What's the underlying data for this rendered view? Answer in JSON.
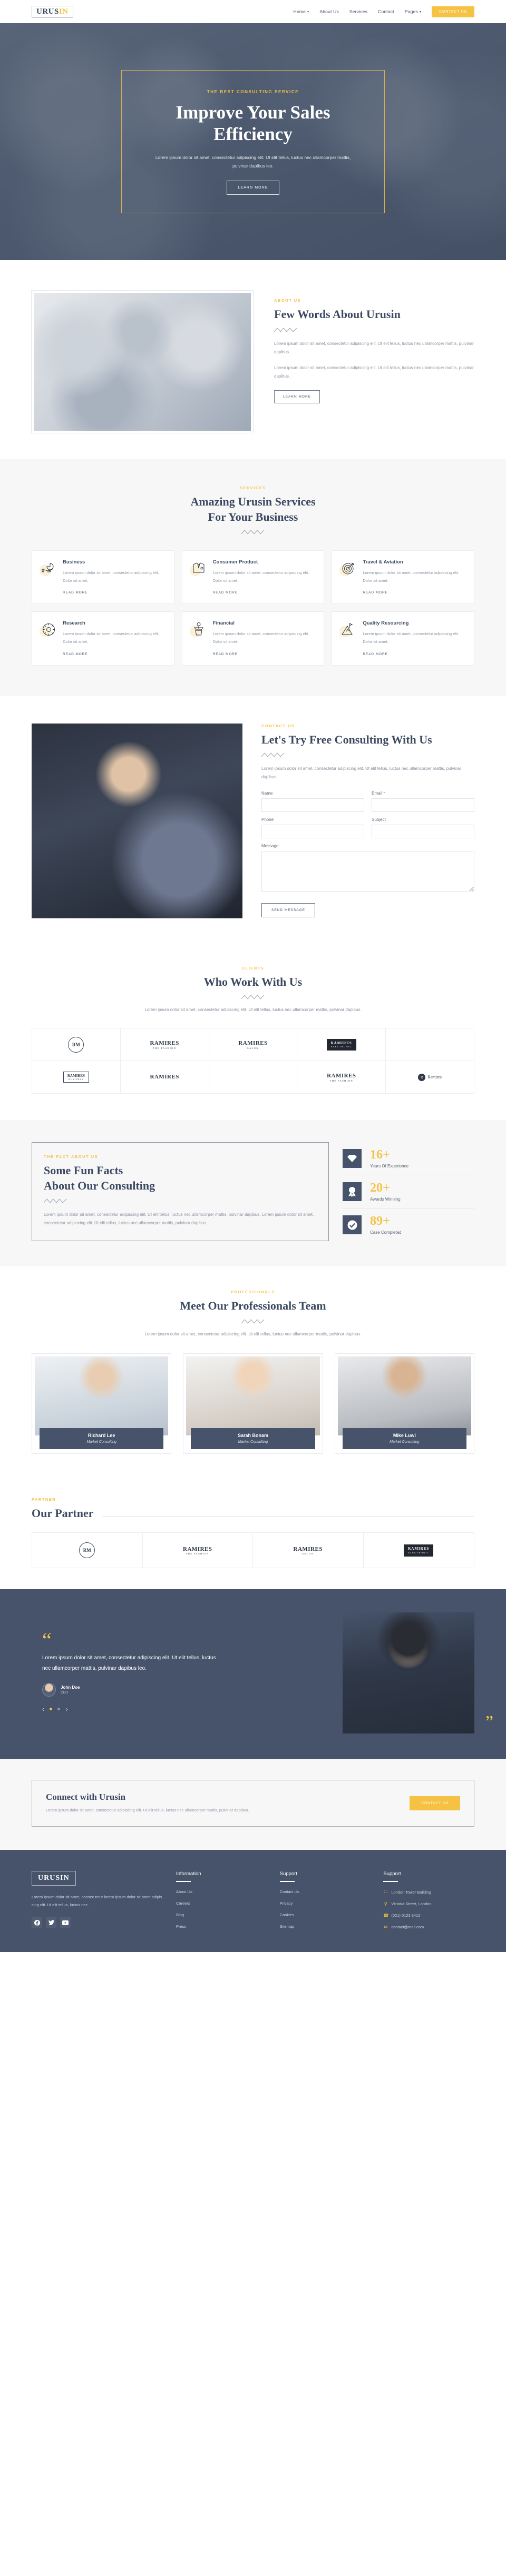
{
  "brand": {
    "name_dark": "URUS",
    "name_accent": "IN",
    "full": "URUSIN"
  },
  "nav": {
    "items": [
      {
        "label": "Home",
        "caret": "▾"
      },
      {
        "label": "About Us",
        "caret": ""
      },
      {
        "label": "Services",
        "caret": ""
      },
      {
        "label": "Contact",
        "caret": ""
      },
      {
        "label": "Pages",
        "caret": "▾"
      }
    ],
    "cta": "CONTACT US"
  },
  "hero": {
    "eyebrow": "THE BEST CONSULTING SERVICE",
    "title": "Improve Your Sales Efficiency",
    "subtitle": "Lorem ipsum dolor sit amet, consectetur adipiscing elit. Ut elit tellus, luctus nec ullamcorper mattis, pulvinar dapibus leo.",
    "button": "LEARN MORE"
  },
  "about": {
    "label": "ABOUT US",
    "title": "Few Words About Urusin",
    "p1": "Lorem ipsum dolor sit amet, consectetur adipiscing elit. Ut elit tellus, luctus nec ullamcorper mattis, pulvinar dapibus.",
    "p2": "Lorem ipsum dolor sit amet, consectetur adipiscing elit. Ut elit tellus, luctus nec ullamcorper mattis, pulvinar dapibus .",
    "button": "LEARN MORE"
  },
  "services": {
    "label": "SERVICES",
    "title_line1": "Amazing Urusin Services",
    "title_line2": "For Your Business",
    "read_more": "READ MORE",
    "cards": [
      {
        "title": "Business",
        "icon": "pie-chart-hand-icon",
        "text": "Lorem ipsum dolor sit amet, consectetur adipiscing elit. Dolor sit amet."
      },
      {
        "title": "Consumer Product",
        "icon": "shirt-icon",
        "text": "Lorem ipsum dolor sit amet, consectetur adipiscing elit. Dolor sit amet."
      },
      {
        "title": "Travel & Aviation",
        "icon": "target-dart-icon",
        "text": "Lorem ipsum dolor sit amet, consectetur adipiscing elit. Dolor sit amet."
      },
      {
        "title": "Research",
        "icon": "gear-search-icon",
        "text": "Lorem ipsum dolor sit amet, consectetur adipiscing elit. Dolor sit amet."
      },
      {
        "title": "Financial",
        "icon": "money-plant-icon",
        "text": "Lorem ipsum dolor sit amet, consectetur adipiscing elit. Dolor sit amet."
      },
      {
        "title": "Quality Resourcing",
        "icon": "mountain-flag-icon",
        "text": "Lorem ipsum dolor sit amet, consectetur adipiscing elit. Dolor sit amet."
      }
    ]
  },
  "contact": {
    "label": "CONTACT US",
    "title": "Let's Try Free Consulting With Us",
    "text": "Lorem ipsum dolor sit amet, consectetur adipiscing elit. Ut elit tellus, luctus nec ullamcorper mattis, pulvinar dapibus.",
    "fields": {
      "name": "Name",
      "email": "Email",
      "email_required": "*",
      "phone": "Phone",
      "subject": "Subject",
      "message": "Message"
    },
    "values": {
      "name": "",
      "email": "",
      "phone": "",
      "subject": "",
      "message": ""
    },
    "submit": "SEND MESSAGE"
  },
  "clients": {
    "label": "CLIENTS",
    "title": "Who Work With Us",
    "text": "Lorem ipsum dolor sit amet, consectetur adipiscing elit. Ut elit tellus, luctus nec ullamcorper mattis, pulvinar dapibus.",
    "logos": [
      {
        "type": "circle",
        "main": "RM",
        "sub": ""
      },
      {
        "type": "mark",
        "main": "RAMIRES",
        "sub": "THE FASHION"
      },
      {
        "type": "mark",
        "main": "RAMIRES",
        "sub": "SALON"
      },
      {
        "type": "bar",
        "main": "RAMIRES",
        "sub": "ELECTRONIC"
      },
      {
        "type": "blank",
        "main": "",
        "sub": ""
      },
      {
        "type": "square",
        "main": "RAMIRES",
        "sub": "BUSINESS"
      },
      {
        "type": "mark",
        "main": "RAMIRES",
        "sub": ""
      },
      {
        "type": "blank",
        "main": "",
        "sub": ""
      },
      {
        "type": "mark",
        "main": "RAMIRES",
        "sub": "THE FASHION"
      },
      {
        "type": "circle2",
        "main": "R",
        "sub": "Ramires"
      }
    ]
  },
  "facts": {
    "label": "THE FACT ABOUT US",
    "title_line1": "Some Fun Facts",
    "title_line2": "About Our Consulting",
    "text": "Lorem ipsum dolor sit amet, consectetur adipiscing elit. Ut elit tellus, luctus nec ullamcorper mattis, pulvinar dapibus. Lorem ipsum dolor sit amet, consectetur adipiscing elit. Ut elit tellus, luctus nec ullamcorper mattis, pulvinar dapibus.",
    "stats": [
      {
        "value": "16+",
        "label": "Years Of Experience",
        "icon": "diamond-icon"
      },
      {
        "value": "20+",
        "label": "Awards Winning",
        "icon": "award-badge-icon"
      },
      {
        "value": "89+",
        "label": "Case Completed",
        "icon": "check-circle-icon"
      }
    ]
  },
  "team": {
    "label": "PROFESSIONALS",
    "title": "Meet Our Professionals Team",
    "text": "Lorem ipsum dolor sit amet, consectetur adipiscing elit. Ut elit tellus, luctus nec ullamcorper mattis, pulvinar dapibus.",
    "members": [
      {
        "name": "Richard Lee",
        "role": "Market Consulting"
      },
      {
        "name": "Sarah Bonam",
        "role": "Market Consulting"
      },
      {
        "name": "Mike Luwi",
        "role": "Market Consulting"
      }
    ]
  },
  "partner": {
    "label": "PARTNER",
    "title": "Our Partner",
    "logos": [
      {
        "type": "circle",
        "main": "RM",
        "sub": ""
      },
      {
        "type": "mark",
        "main": "RAMIRES",
        "sub": "THE FASHION"
      },
      {
        "type": "mark",
        "main": "RAMIRES",
        "sub": "SALON"
      },
      {
        "type": "bar",
        "main": "RAMIRES",
        "sub": "ELECTRONIC"
      }
    ]
  },
  "testimonial": {
    "quote_open": "“",
    "quote_close": "”",
    "text": "Lorem ipsum dolor sit amet, consectetur adipiscing elit. Ut elit tellus, luctus nec ullamcorper mattis, pulvinar dapibus leo.",
    "author": "John Doe",
    "role": "CEO",
    "prev": "‹",
    "next": "›"
  },
  "cta": {
    "title": "Connect with Urusin",
    "text": "Lorem ipsum dolor sit amet, consectetur adipiscing elit. Ut elit tellus, luctus nec ullamcorper mattis, pulvinar dapibus.",
    "button": "CONTACT US"
  },
  "footer": {
    "logo": "URUSIN",
    "desc": "Lorem ipsum dolor sit amet, consec tetur lorem ipsum dolor sit amet adipis cing elit. Ut elit tellus, luctus nec.",
    "socials": [
      {
        "name": "facebook-icon",
        "glyph": "f"
      },
      {
        "name": "twitter-icon",
        "glyph": "ᵛ"
      },
      {
        "name": "youtube-icon",
        "glyph": "▶"
      }
    ],
    "columns": [
      {
        "title": "Information",
        "links": [
          "About Us",
          "Careers",
          "Blog",
          "Press"
        ]
      },
      {
        "title": "Support",
        "links": [
          "Contact Us",
          "Privacy",
          "Cookies",
          "Sitemap"
        ]
      }
    ],
    "contact_title": "Support",
    "contact_items": [
      {
        "icon": "building-icon",
        "glyph": "Ἶ2",
        "text": "London Tower Building"
      },
      {
        "icon": "map-pin-icon",
        "glyph": "⚑",
        "text": "Victoria Street, London"
      },
      {
        "icon": "phone-icon",
        "glyph": "☎",
        "text": "(021) 0123 3412"
      },
      {
        "icon": "mail-icon",
        "glyph": "✉",
        "text": "contact@mail.com"
      }
    ]
  },
  "colors": {
    "accent": "#f5c243",
    "dark": "#46536a",
    "muted": "#8d94a1"
  }
}
